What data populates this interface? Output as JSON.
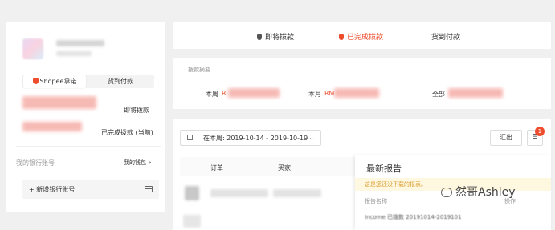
{
  "sidebar": {
    "tabs": {
      "shopee": "Shopee承诺",
      "cod": "货到付款"
    },
    "pending_label": "即将拨款",
    "completed_label": "已完成拨款 (当前)",
    "bank_account_label": "我的银行账号",
    "wallet_link": "我的钱包 »",
    "add_bank_account": "+ 新增银行账号"
  },
  "top_tabs": [
    "即将拨款",
    "已完成拨款",
    "货到付款"
  ],
  "summary": {
    "title": "拨款摘要",
    "week_label": "本周",
    "week_prefix": "R",
    "month_label": "本月",
    "month_prefix": "RM",
    "all_label": "全部"
  },
  "list": {
    "date_range": "在本周: 2019-10-14 - 2019-10-19",
    "export_label": "汇出",
    "badge_count": "1",
    "col_order": "订单",
    "col_buyer": "买家"
  },
  "report": {
    "title": "最新报告",
    "notice": "这是您还没下载的报表。",
    "col_name": "报告名称",
    "col_action": "操作",
    "row_preview": "Income 已拨款 20191014-2019101"
  },
  "watermark": "然哥Ashley",
  "colors": {
    "accent": "#ee4d2d",
    "background": "#f0f0f0",
    "panel": "#ffffff"
  }
}
